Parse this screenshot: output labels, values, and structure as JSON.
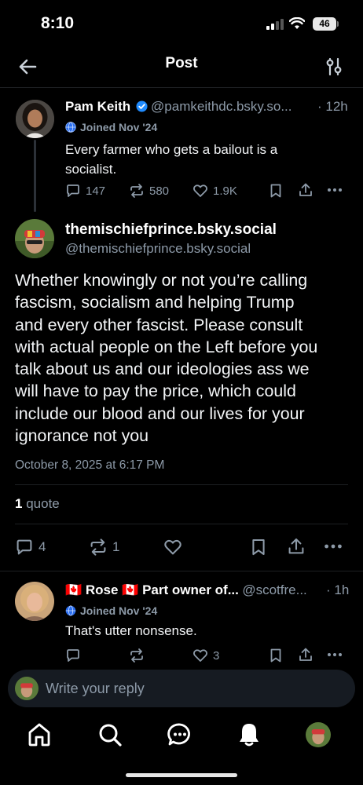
{
  "status_bar": {
    "time": "8:10",
    "battery": "46"
  },
  "header": {
    "title": "Post",
    "back_icon": "arrow-left-icon",
    "filter_icon": "sliders-icon"
  },
  "parent_post": {
    "display_name": "Pam Keith",
    "verified": true,
    "handle": "@pamkeithdc.bsky.so...",
    "time_ago": "· 12h",
    "joined": "Joined Nov '24",
    "text_line1": "Every farmer who gets a bailout is a",
    "text_line2": "socialist.",
    "replies": "147",
    "reposts": "580",
    "likes": "1.9K"
  },
  "main_post": {
    "display_name": "themischiefprince.bsky.social",
    "handle": "@themischiefprince.bsky.social",
    "text_lines": [
      "Whether knowingly or not you’re calling",
      "fascism, socialism and helping Trump",
      "and every other fascist. Please consult",
      "with actual people on the Left before you",
      "talk about us and our ideologies ass we",
      "will have to pay the price, which could",
      "include our blood and our lives for your",
      "ignorance not you"
    ],
    "timestamp": "October 8, 2025 at 6:17 PM",
    "quote_count": "1",
    "quote_label": "quote",
    "replies": "4",
    "reposts": "1"
  },
  "reply_post": {
    "display_name": "🇨🇦 Rose 🇨🇦 Part owner of...",
    "handle": "@scotfre...",
    "time_ago": "· 1h",
    "joined": "Joined Nov '24",
    "text": "That's utter nonsense.",
    "likes": "3"
  },
  "reply_bar": {
    "placeholder": "Write your reply"
  },
  "tab_bar": {
    "tabs": [
      {
        "icon": "home-icon"
      },
      {
        "icon": "search-icon"
      },
      {
        "icon": "chat-icon"
      },
      {
        "icon": "bell-icon"
      },
      {
        "icon": "profile-avatar"
      }
    ]
  },
  "colors": {
    "background": "#000000",
    "muted": "#8d9aa8",
    "verified": "#208bfe",
    "reply_bar": "#161b22"
  }
}
